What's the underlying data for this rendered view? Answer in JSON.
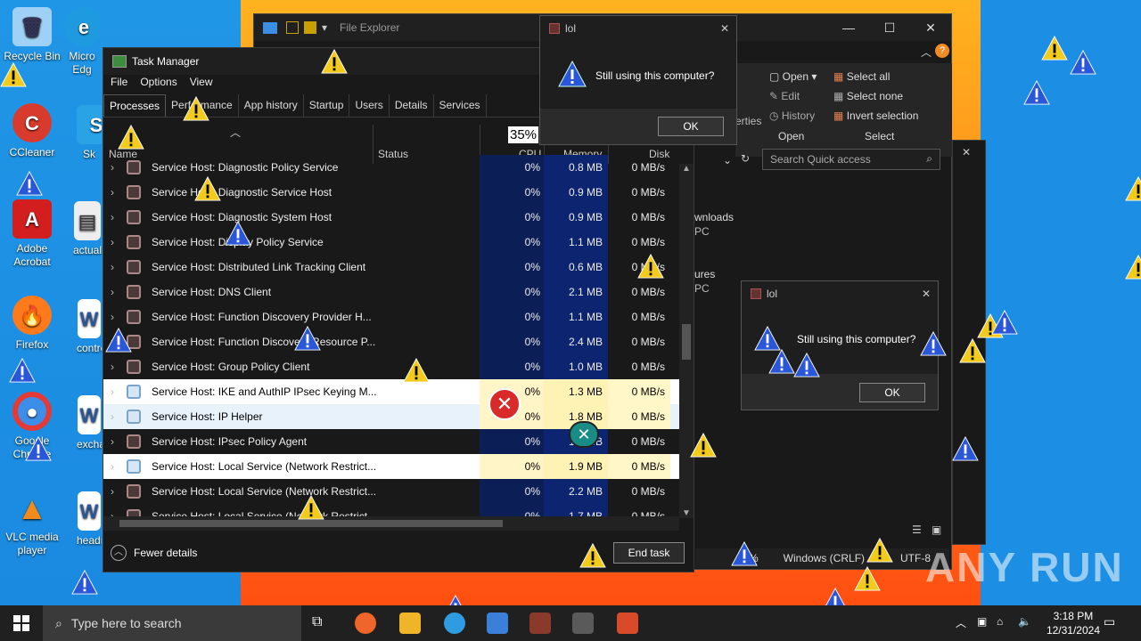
{
  "desktop": {
    "icons": [
      {
        "label": "Recycle Bin",
        "color": "#9fd0f5"
      },
      {
        "label": "CCleaner",
        "color": "#d83b2d"
      },
      {
        "label": "Adobe Acrobat",
        "color": "#d21e1e"
      },
      {
        "label": "Firefox",
        "color": "#ff7a1a"
      },
      {
        "label": "Google Chrome",
        "color": "#3d8ee8"
      },
      {
        "label": "VLC media player",
        "color": "#f28b1c"
      }
    ],
    "partial_icons": [
      "Micro Edg",
      "Sk",
      "actuals",
      "contro",
      "exchan",
      "headr"
    ]
  },
  "file_explorer": {
    "title": "File Explorer",
    "ribbon": {
      "open": "Open",
      "edit": "Edit",
      "history": "History",
      "select_all": "Select all",
      "select_none": "Select none",
      "invert_selection": "Invert selection",
      "group_open": "Open",
      "group_select": "Select",
      "properties_partial": "erties"
    },
    "search_placeholder": "Search Quick access",
    "nav": [
      "wnloads",
      "PC",
      "ures",
      "PC"
    ],
    "status_encoding": "Windows (CRLF)",
    "status_utf": "UTF-8",
    "status_pct": "%"
  },
  "task_manager": {
    "title": "Task Manager",
    "menu": [
      "File",
      "Options",
      "View"
    ],
    "tabs": [
      "Processes",
      "Performance",
      "App history",
      "Startup",
      "Users",
      "Details",
      "Services"
    ],
    "cpu_total": "35%",
    "columns": {
      "name": "Name",
      "status": "Status",
      "cpu": "CPU",
      "memory": "Memory",
      "disk": "Disk"
    },
    "rows": [
      {
        "name": "Service Host: Diagnostic Policy Service",
        "cpu": "0%",
        "mem": "0.8 MB",
        "disk": "0 MB/s",
        "hl": ""
      },
      {
        "name": "Service Host: Diagnostic Service Host",
        "cpu": "0%",
        "mem": "0.9 MB",
        "disk": "0 MB/s",
        "hl": ""
      },
      {
        "name": "Service Host: Diagnostic System Host",
        "cpu": "0%",
        "mem": "0.9 MB",
        "disk": "0 MB/s",
        "hl": ""
      },
      {
        "name": "Service Host: Display Policy Service",
        "cpu": "0%",
        "mem": "1.1 MB",
        "disk": "0 MB/s",
        "hl": ""
      },
      {
        "name": "Service Host: Distributed Link Tracking Client",
        "cpu": "0%",
        "mem": "0.6 MB",
        "disk": "0 MB/s",
        "hl": ""
      },
      {
        "name": "Service Host: DNS Client",
        "cpu": "0%",
        "mem": "2.1 MB",
        "disk": "0 MB/s",
        "hl": ""
      },
      {
        "name": "Service Host: Function Discovery Provider H...",
        "cpu": "0%",
        "mem": "1.1 MB",
        "disk": "0 MB/s",
        "hl": ""
      },
      {
        "name": "Service Host: Function Discovery Resource P...",
        "cpu": "0%",
        "mem": "2.4 MB",
        "disk": "0 MB/s",
        "hl": ""
      },
      {
        "name": "Service Host: Group Policy Client",
        "cpu": "0%",
        "mem": "1.0 MB",
        "disk": "0 MB/s",
        "hl": ""
      },
      {
        "name": "Service Host: IKE and AuthIP IPsec Keying M...",
        "cpu": "0%",
        "mem": "1.3 MB",
        "disk": "0 MB/s",
        "hl": "hl"
      },
      {
        "name": "Service Host: IP Helper",
        "cpu": "0%",
        "mem": "1.8 MB",
        "disk": "0 MB/s",
        "hl": "hl2"
      },
      {
        "name": "Service Host: IPsec Policy Agent",
        "cpu": "0%",
        "mem": "1.3 MB",
        "disk": "0 MB/s",
        "hl": ""
      },
      {
        "name": "Service Host: Local Service (Network Restrict...",
        "cpu": "0%",
        "mem": "1.9 MB",
        "disk": "0 MB/s",
        "hl": "hl"
      },
      {
        "name": "Service Host: Local Service (Network Restrict...",
        "cpu": "0%",
        "mem": "2.2 MB",
        "disk": "0 MB/s",
        "hl": ""
      },
      {
        "name": "Service Host: Local Service (Network Restrict...",
        "cpu": "0%",
        "mem": "1.7 MB",
        "disk": "0 MB/s",
        "hl": ""
      }
    ],
    "fewer_details": "Fewer details",
    "end_task": "End task"
  },
  "dialog1": {
    "title": "lol",
    "message": "Still using this computer?",
    "ok": "OK"
  },
  "dialog2": {
    "title": "lol",
    "message": "Still using this computer?",
    "ok": "OK"
  },
  "taskbar": {
    "search_placeholder": "Type here to search",
    "time": "3:18 PM",
    "date": "12/31/2024"
  },
  "watermark": "ANY RUN"
}
